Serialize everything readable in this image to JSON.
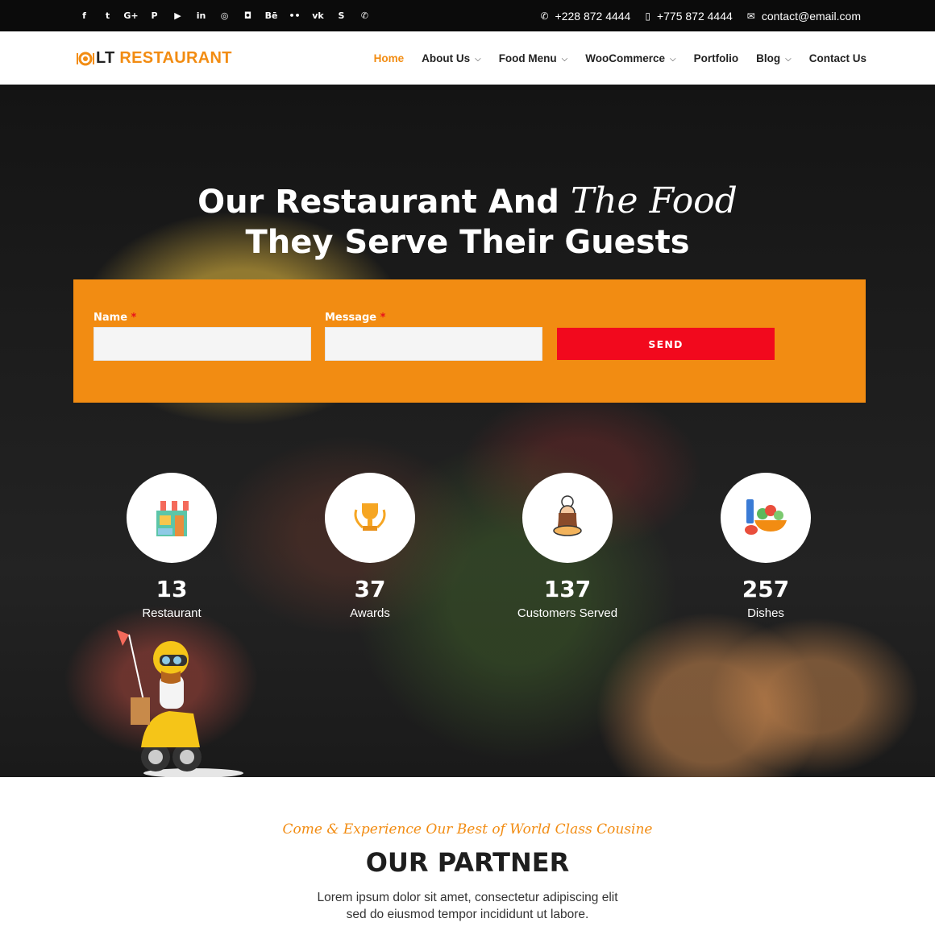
{
  "topbar": {
    "socials": [
      {
        "icon": "facebook-icon",
        "glyph": "f"
      },
      {
        "icon": "twitter-icon",
        "glyph": "t"
      },
      {
        "icon": "google-plus-icon",
        "glyph": "G+"
      },
      {
        "icon": "pinterest-icon",
        "glyph": "P"
      },
      {
        "icon": "youtube-icon",
        "glyph": "▶"
      },
      {
        "icon": "linkedin-icon",
        "glyph": "in"
      },
      {
        "icon": "dribbble-icon",
        "glyph": "◎"
      },
      {
        "icon": "instagram-icon",
        "glyph": "◘"
      },
      {
        "icon": "behance-icon",
        "glyph": "Bē"
      },
      {
        "icon": "flickr-icon",
        "glyph": "••"
      },
      {
        "icon": "vk-icon",
        "glyph": "vk"
      },
      {
        "icon": "skype-icon",
        "glyph": "S"
      },
      {
        "icon": "whatsapp-icon",
        "glyph": "✆"
      }
    ],
    "phone1": "+228 872 4444",
    "phone2": "+775 872 4444",
    "email": "contact@email.com"
  },
  "header": {
    "logo_lt": "LT",
    "logo_restaurant": "RESTAURANT",
    "nav": [
      {
        "label": "Home",
        "active": true,
        "dropdown": false
      },
      {
        "label": "About Us",
        "active": false,
        "dropdown": true
      },
      {
        "label": "Food Menu",
        "active": false,
        "dropdown": true
      },
      {
        "label": "WooCommerce",
        "active": false,
        "dropdown": true
      },
      {
        "label": "Portfolio",
        "active": false,
        "dropdown": false
      },
      {
        "label": "Blog",
        "active": false,
        "dropdown": true
      },
      {
        "label": "Contact Us",
        "active": false,
        "dropdown": false
      }
    ]
  },
  "hero": {
    "title_part1": "Our Restaurant And",
    "title_script": "The Food",
    "title_line2": "They Serve Their Guests"
  },
  "form": {
    "name_label": "Name",
    "message_label": "Message",
    "required_mark": "*",
    "send_label": "SEND"
  },
  "stats": [
    {
      "icon": "restaurant-shop-icon",
      "number": "13",
      "label": "Restaurant"
    },
    {
      "icon": "trophy-icon",
      "number": "37",
      "label": "Awards"
    },
    {
      "icon": "chef-icon",
      "number": "137",
      "label": "Customers Served"
    },
    {
      "icon": "dishes-icon",
      "number": "257",
      "label": "Dishes"
    }
  ],
  "partner": {
    "tagline": "Come & Experience Our Best of World Class Cousine",
    "heading": "OUR PARTNER",
    "text_line1": "Lorem ipsum dolor sit amet, consectetur adipiscing elit",
    "text_line2": "sed do eiusmod tempor incididunt ut labore."
  },
  "colors": {
    "accent": "#f28c12",
    "send_button": "#f2091d",
    "topbar": "#0b0b0b"
  }
}
